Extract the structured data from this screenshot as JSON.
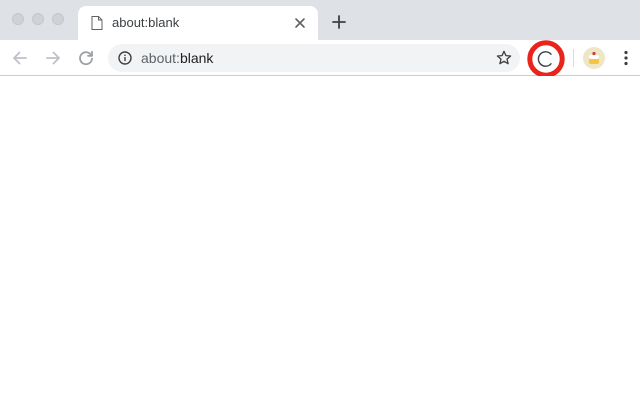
{
  "window": {
    "traffic_lights": [
      "close",
      "minimize",
      "maximize"
    ]
  },
  "tab": {
    "title": "about:blank",
    "icon": "page-icon",
    "close_icon": "close-icon"
  },
  "new_tab": {
    "icon": "plus-icon"
  },
  "toolbar": {
    "back_icon": "arrow-left-icon",
    "forward_icon": "arrow-right-icon",
    "reload_icon": "reload-icon",
    "omnibox": {
      "info_icon": "info-icon",
      "url_scheme": "about:",
      "url_rest": "blank",
      "bookmark_icon": "star-icon"
    },
    "extension": {
      "icon": "circle-c-icon",
      "highlight_color": "#e8241c"
    },
    "profile_icon": "avatar-icon",
    "menu_icon": "kebab-menu-icon"
  },
  "colors": {
    "tabstrip": "#dee1e6",
    "omnibox": "#f1f3f4",
    "highlight": "#e8241c"
  }
}
